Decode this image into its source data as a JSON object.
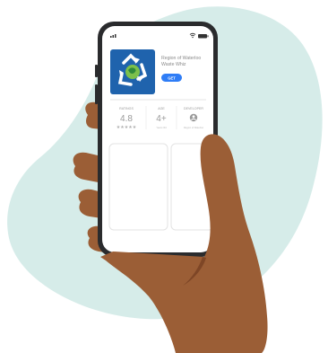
{
  "phone": {
    "status_bar": {
      "signal_icon": "signal-bars-icon",
      "wifi_icon": "wifi-icon",
      "battery_icon": "battery-icon"
    },
    "app_store_listing": {
      "app_icon": "recycle-globe-icon",
      "app_name_line1": "Region of Waterloo",
      "app_name_line2": "Waste Whiz",
      "get_button_label": "GET",
      "stats": [
        {
          "header": "RATINGS",
          "value": "4.8",
          "sub": "★★★★★"
        },
        {
          "header": "AGE",
          "value": "4+",
          "sub": "Years Old"
        },
        {
          "header": "DEVELOPER",
          "value": "",
          "sub": "Region of Waterloo"
        }
      ]
    }
  },
  "colors": {
    "blob": "#d6ece9",
    "skin": "#9b5e36",
    "skin_shadow": "#7e4626",
    "phone_frame": "#2a2b2d",
    "app_icon_bg": "#1f63ad",
    "get_button": "#2f7df6"
  }
}
